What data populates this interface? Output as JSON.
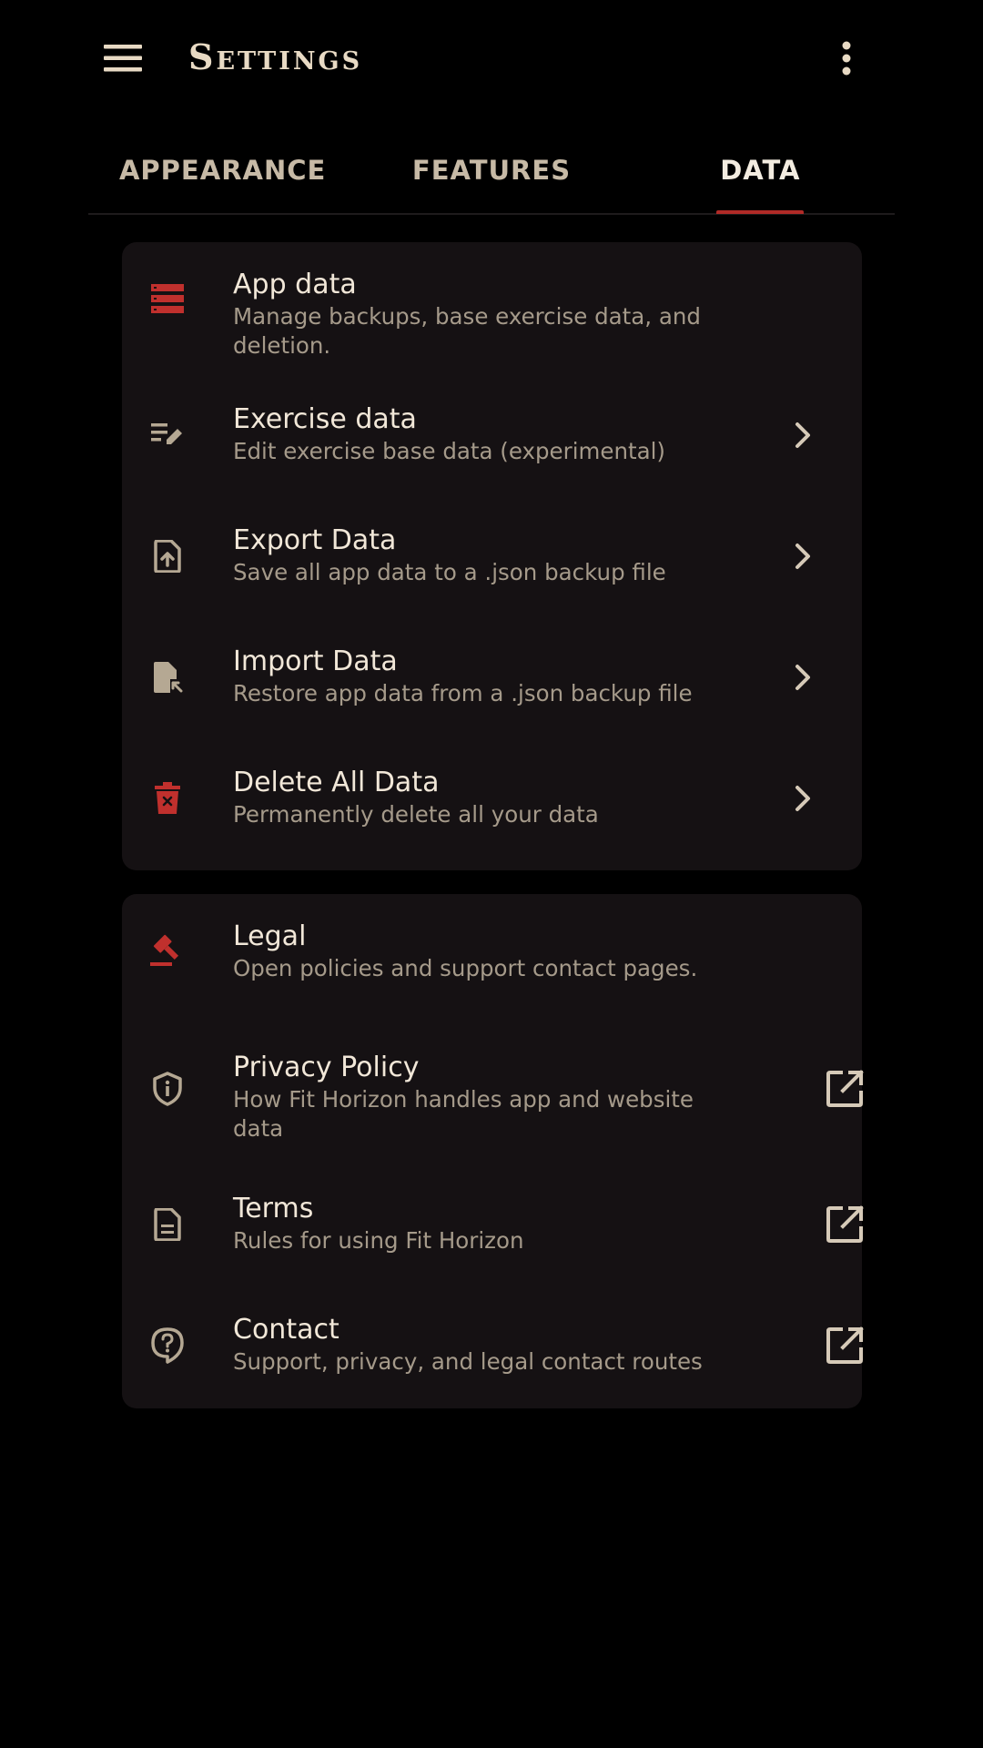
{
  "appbar": {
    "title": "Settings",
    "menu_icon": "hamburger-menu-icon",
    "more_icon": "more-vertical-icon"
  },
  "tabs": [
    {
      "label": "APPEARANCE",
      "active": false
    },
    {
      "label": "FEATURES",
      "active": false
    },
    {
      "label": "DATA",
      "active": true
    }
  ],
  "colors": {
    "accent": "#b02a27",
    "icon_red": "#c0302d",
    "icon_muted": "#b5a893",
    "card_bg": "#151113",
    "page_bg": "#000000"
  },
  "data_section": {
    "header": {
      "title": "App data",
      "subtitle": "Manage backups, base exercise data, and deletion.",
      "icon": "storage-icon"
    },
    "items": [
      {
        "title": "Exercise data",
        "subtitle": "Edit exercise base data (experimental)",
        "icon": "edit-note-icon",
        "trail_icon": "chevron-right-icon"
      },
      {
        "title": "Export Data",
        "subtitle": "Save all app data to a .json backup file",
        "icon": "file-upload-icon",
        "trail_icon": "chevron-right-icon"
      },
      {
        "title": "Import Data",
        "subtitle": "Restore app data from a .json backup file",
        "icon": "file-import-icon",
        "trail_icon": "chevron-right-icon"
      },
      {
        "title": "Delete All Data",
        "subtitle": "Permanently delete all your data",
        "icon": "delete-forever-icon",
        "trail_icon": "chevron-right-icon"
      }
    ]
  },
  "legal_section": {
    "header": {
      "title": "Legal",
      "subtitle": "Open policies and support contact pages.",
      "icon": "gavel-icon"
    },
    "items": [
      {
        "title": "Privacy Policy",
        "subtitle": "How Fit Horizon handles app and website data",
        "icon": "privacy-shield-icon",
        "trail_icon": "open-in-new-icon"
      },
      {
        "title": "Terms",
        "subtitle": "Rules for using Fit Horizon",
        "icon": "document-icon",
        "trail_icon": "open-in-new-icon"
      },
      {
        "title": "Contact",
        "subtitle": "Support, privacy, and legal contact routes",
        "icon": "contact-support-icon",
        "trail_icon": "open-in-new-icon"
      }
    ]
  }
}
